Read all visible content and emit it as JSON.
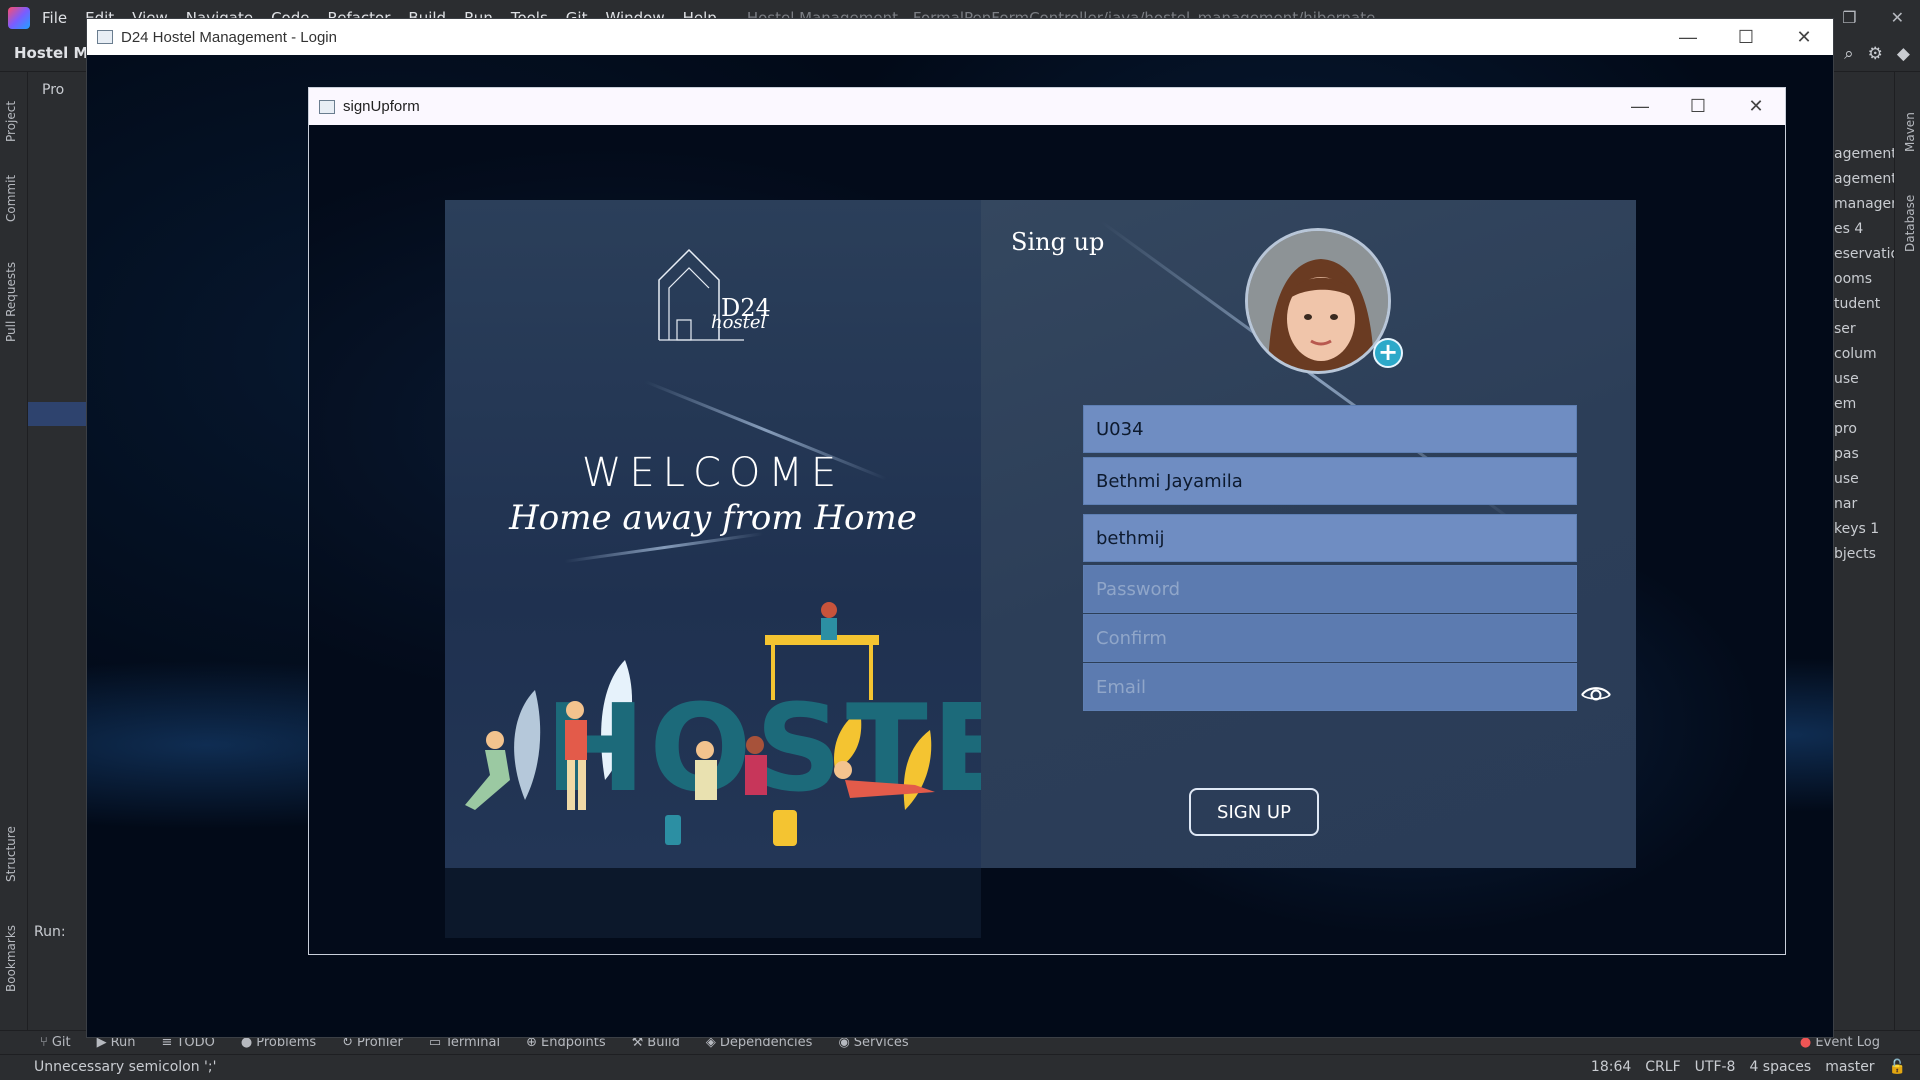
{
  "ide": {
    "menu": [
      "File",
      "Edit",
      "View",
      "Navigate",
      "Code",
      "Refactor",
      "Build",
      "Run",
      "Tools",
      "Git",
      "Window",
      "Help"
    ],
    "title_dim": "Hostel Management - FormalPenFormController/java/hostel_management/hibernate",
    "project_name": "Hostel Ma",
    "project_tab": "Pro",
    "left_vtabs": [
      "Project",
      "Commit",
      "Pull Requests",
      "Structure",
      "Bookmarks"
    ],
    "right_vtabs": [
      "Maven",
      "Database"
    ],
    "run_label": "Run:",
    "right_panel_rows": [
      "agement",
      "agement",
      "managem",
      "es 4",
      "eservatio",
      "ooms",
      "tudent",
      "ser",
      "colum",
      "use",
      "em",
      "pro",
      "pas",
      "use",
      "nar",
      "keys 1",
      "bjects"
    ],
    "tool_windows": [
      "Git",
      "Run",
      "TODO",
      "Problems",
      "Profiler",
      "Terminal",
      "Endpoints",
      "Build",
      "Dependencies",
      "Services"
    ],
    "event_log": "Event Log",
    "status_message": "Unnecessary semicolon ';'",
    "status_right": [
      "18:64",
      "CRLF",
      "UTF-8",
      "4 spaces",
      "master"
    ]
  },
  "login_window": {
    "title": "D24 Hostel Management - Login"
  },
  "signup_window": {
    "title": "signUpform",
    "controls": {
      "minimize": "—",
      "maximize": "☐",
      "close": "✕"
    }
  },
  "left_panel": {
    "logo_text": "D24",
    "logo_script": "hostel",
    "welcome": "WELCOME",
    "tagline": "Home away from Home",
    "hero_word": "HOSTEL"
  },
  "form": {
    "heading": "Sing up",
    "user_id": {
      "value": "U034",
      "placeholder": ""
    },
    "name": {
      "value": "Bethmi Jayamila",
      "placeholder": ""
    },
    "username": {
      "value": "bethmij",
      "placeholder": ""
    },
    "password": {
      "value": "",
      "placeholder": "Password"
    },
    "confirm": {
      "value": "",
      "placeholder": "Confirm"
    },
    "email": {
      "value": "",
      "placeholder": "Email"
    },
    "submit_label": "SIGN UP",
    "avatar_add_symbol": "+"
  },
  "colors": {
    "field_filled": "#6f8dc2",
    "field_empty": "#5c7bb0",
    "avatar_add": "#2ca9c9",
    "hostel_teal": "#1c6a7a"
  }
}
